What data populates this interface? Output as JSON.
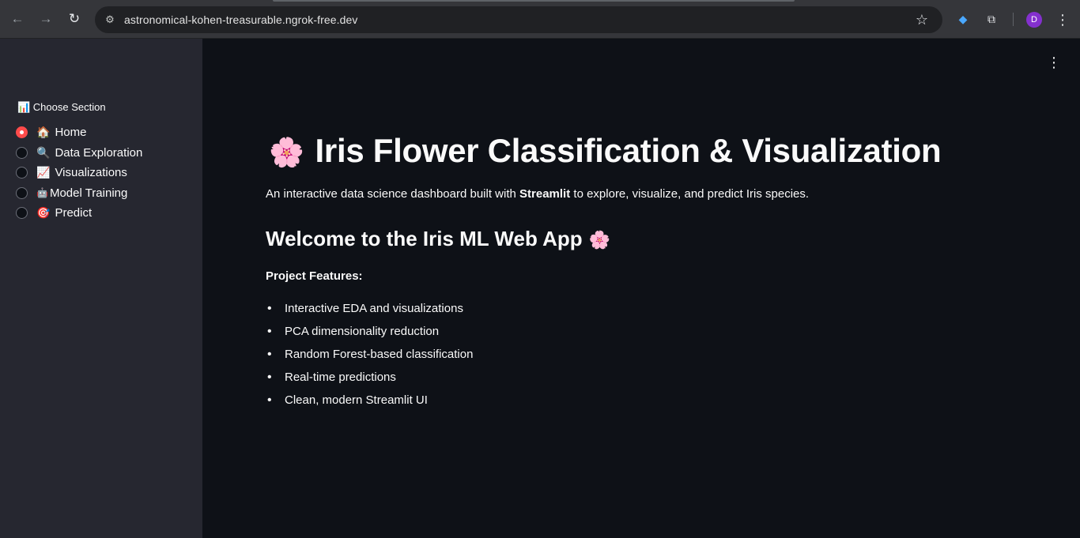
{
  "browser": {
    "url": "astronomical-kohen-treasurable.ngrok-free.dev",
    "back_icon": "arrow-left",
    "forward_icon": "arrow-right",
    "reload_icon": "reload",
    "avatar_initial": "D",
    "accent": "#8430ce"
  },
  "sidebar": {
    "section_label": "📊 Choose Section",
    "options": [
      {
        "emoji": "🏠",
        "label": "Home",
        "checked": true
      },
      {
        "emoji": "🔍",
        "label": "Data Exploration",
        "checked": false
      },
      {
        "emoji": "📈",
        "label": "Visualizations",
        "checked": false
      },
      {
        "emoji": "🤖",
        "label": "Model Training",
        "checked": false
      },
      {
        "emoji": "🎯",
        "label": "Predict",
        "checked": false
      }
    ],
    "radio_color": "#ff4b4b"
  },
  "main": {
    "title_emoji": "🌸",
    "title": "Iris Flower Classification & Visualization",
    "intro_before": "An interactive data science dashboard built with ",
    "intro_bold": "Streamlit",
    "intro_after": " to explore, visualize, and predict Iris species.",
    "subheading": "Welcome to the Iris ML Web App",
    "subheading_emoji": "🌸",
    "features_label": "Project Features:",
    "features": [
      "Interactive EDA and visualizations",
      "PCA dimensionality reduction",
      "Random Forest-based classification",
      "Real-time predictions",
      "Clean, modern Streamlit UI"
    ]
  }
}
